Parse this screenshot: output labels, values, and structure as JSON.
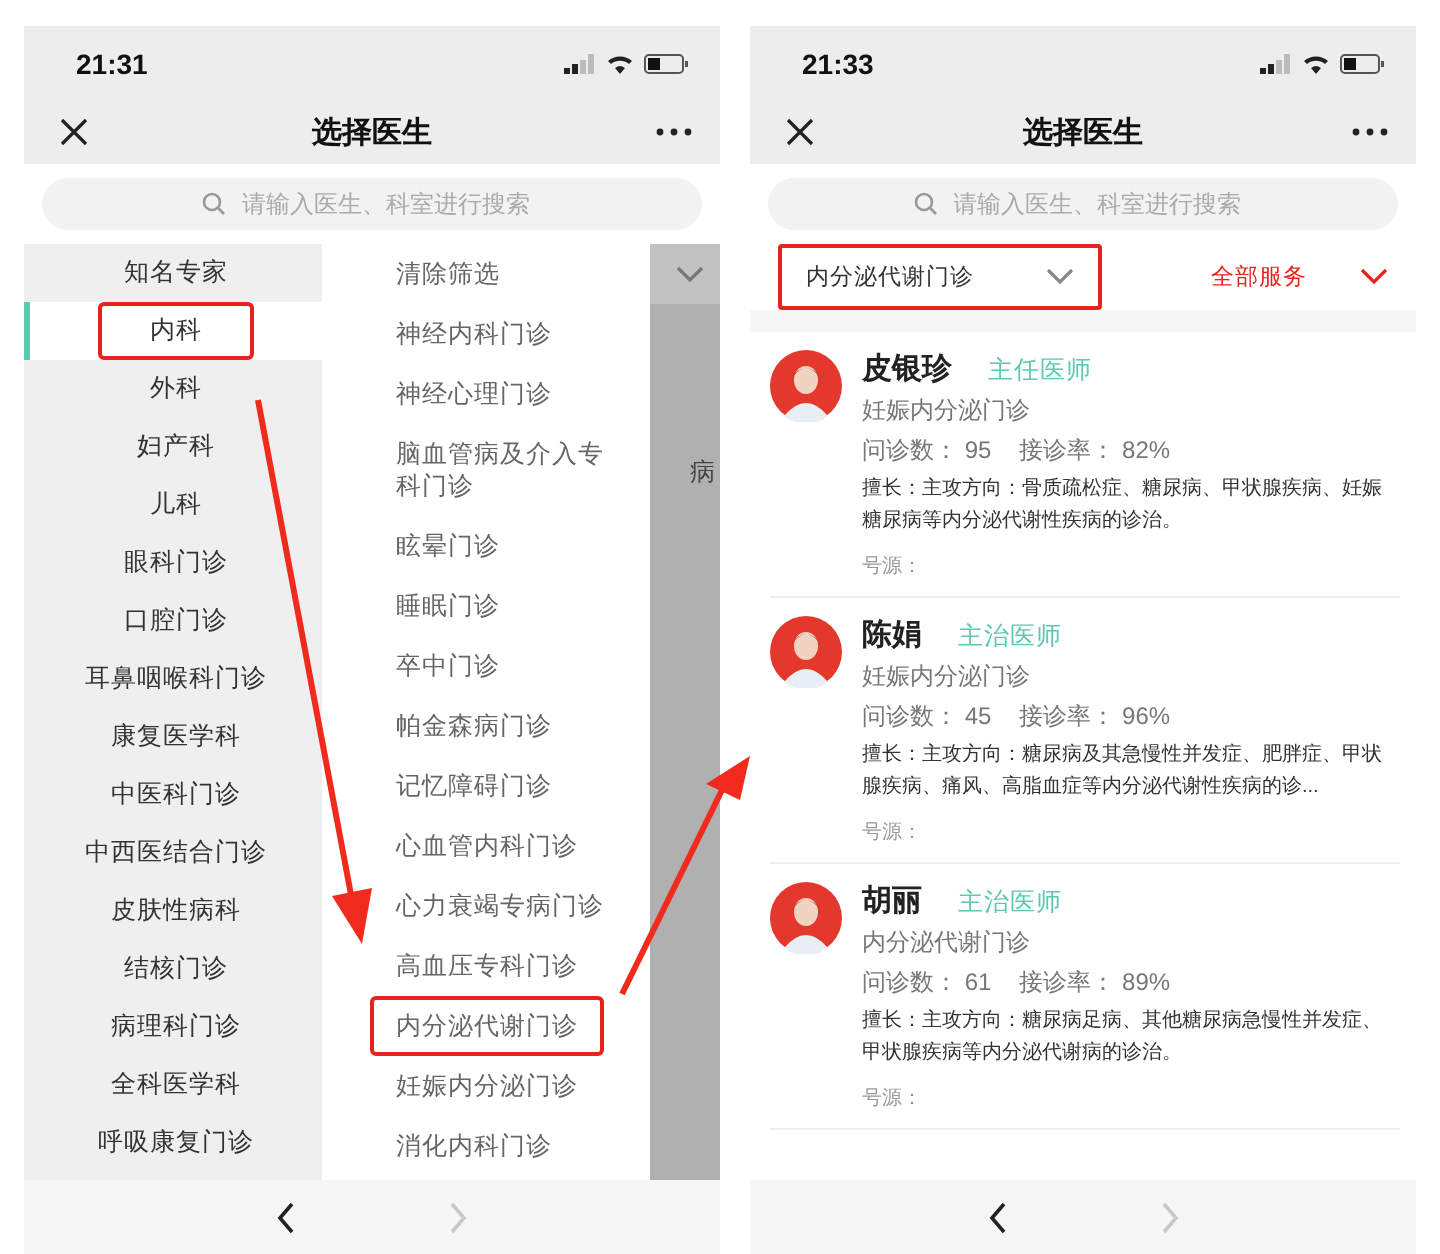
{
  "department_screen": {
    "time": "21:31",
    "title": "选择医生",
    "search": {
      "placeholder": "请输入医生、科室进行搜索"
    },
    "categories": [
      {
        "label": "知名专家",
        "selected": false,
        "highlighted": false
      },
      {
        "label": "内科",
        "selected": true,
        "highlighted": true
      },
      {
        "label": "外科",
        "selected": false,
        "highlighted": false
      },
      {
        "label": "妇产科",
        "selected": false,
        "highlighted": false
      },
      {
        "label": "儿科",
        "selected": false,
        "highlighted": false
      },
      {
        "label": "眼科门诊",
        "selected": false,
        "highlighted": false
      },
      {
        "label": "口腔门诊",
        "selected": false,
        "highlighted": false
      },
      {
        "label": "耳鼻咽喉科门诊",
        "selected": false,
        "highlighted": false
      },
      {
        "label": "康复医学科",
        "selected": false,
        "highlighted": false
      },
      {
        "label": "中医科门诊",
        "selected": false,
        "highlighted": false
      },
      {
        "label": "中西医结合门诊",
        "selected": false,
        "highlighted": false
      },
      {
        "label": "皮肤性病科",
        "selected": false,
        "highlighted": false
      },
      {
        "label": "结核门诊",
        "selected": false,
        "highlighted": false
      },
      {
        "label": "病理科门诊",
        "selected": false,
        "highlighted": false
      },
      {
        "label": "全科医学科",
        "selected": false,
        "highlighted": false
      },
      {
        "label": "呼吸康复门诊",
        "selected": false,
        "highlighted": false
      }
    ],
    "departments": [
      {
        "label": "清除筛选",
        "highlighted": false
      },
      {
        "label": "神经内科门诊",
        "highlighted": false
      },
      {
        "label": "神经心理门诊",
        "highlighted": false
      },
      {
        "label": "脑血管病及介入专科门诊",
        "highlighted": false
      },
      {
        "label": "眩晕门诊",
        "highlighted": false
      },
      {
        "label": "睡眠门诊",
        "highlighted": false
      },
      {
        "label": "卒中门诊",
        "highlighted": false
      },
      {
        "label": "帕金森病门诊",
        "highlighted": false
      },
      {
        "label": "记忆障碍门诊",
        "highlighted": false
      },
      {
        "label": "心血管内科门诊",
        "highlighted": false
      },
      {
        "label": "心力衰竭专病门诊",
        "highlighted": false
      },
      {
        "label": "高血压专科门诊",
        "highlighted": false
      },
      {
        "label": "内分泌代谢门诊",
        "highlighted": true
      },
      {
        "label": "妊娠内分泌门诊",
        "highlighted": false
      },
      {
        "label": "消化内科门诊",
        "highlighted": false
      }
    ],
    "backdrop_text": "病",
    "nav_bar": {
      "back_enabled": true,
      "forward_enabled": false
    }
  },
  "doctor_screen": {
    "time": "21:33",
    "title": "选择医生",
    "search": {
      "placeholder": "请输入医生、科室进行搜索"
    },
    "filters": [
      {
        "label": "内分泌代谢门诊",
        "kind": "department",
        "highlighted": true
      },
      {
        "label": "全部服务",
        "kind": "service",
        "highlighted": false
      }
    ],
    "doctors": [
      {
        "name": "皮银珍",
        "title": "主任医师",
        "department": "妊娠内分泌门诊",
        "consultations_label": "问诊数：",
        "consultations": "95",
        "rate_label": "接诊率：",
        "rate": "82%",
        "expertise": "擅长：主攻方向：骨质疏松症、糖尿病、甲状腺疾病、妊娠糖尿病等内分泌代谢性疾病的诊治。",
        "source_label": "号源："
      },
      {
        "name": "陈娟",
        "title": "主治医师",
        "department": "妊娠内分泌门诊",
        "consultations_label": "问诊数：",
        "consultations": "45",
        "rate_label": "接诊率：",
        "rate": "96%",
        "expertise": "擅长：主攻方向：糖尿病及其急慢性并发症、肥胖症、甲状腺疾病、痛风、高脂血症等内分泌代谢性疾病的诊...",
        "source_label": "号源："
      },
      {
        "name": "胡丽",
        "title": "主治医师",
        "department": "内分泌代谢门诊",
        "consultations_label": "问诊数：",
        "consultations": "61",
        "rate_label": "接诊率：",
        "rate": "89%",
        "expertise": "擅长：主攻方向：糖尿病足病、其他糖尿病急慢性并发症、甲状腺疾病等内分泌代谢病的诊治。",
        "source_label": "号源："
      }
    ],
    "nav_bar": {
      "back_enabled": true,
      "forward_enabled": false
    }
  }
}
